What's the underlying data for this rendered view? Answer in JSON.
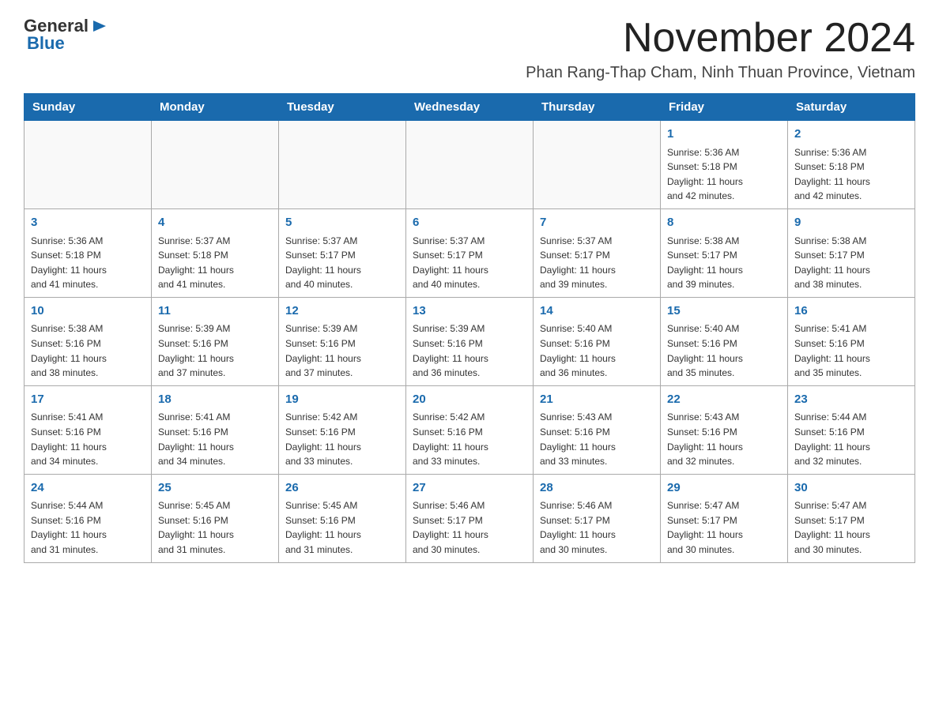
{
  "header": {
    "title": "November 2024",
    "location": "Phan Rang-Thap Cham, Ninh Thuan Province, Vietnam",
    "logo_general": "General",
    "logo_blue": "Blue"
  },
  "days_of_week": [
    "Sunday",
    "Monday",
    "Tuesday",
    "Wednesday",
    "Thursday",
    "Friday",
    "Saturday"
  ],
  "weeks": [
    [
      {
        "day": "",
        "info": ""
      },
      {
        "day": "",
        "info": ""
      },
      {
        "day": "",
        "info": ""
      },
      {
        "day": "",
        "info": ""
      },
      {
        "day": "",
        "info": ""
      },
      {
        "day": "1",
        "info": "Sunrise: 5:36 AM\nSunset: 5:18 PM\nDaylight: 11 hours\nand 42 minutes."
      },
      {
        "day": "2",
        "info": "Sunrise: 5:36 AM\nSunset: 5:18 PM\nDaylight: 11 hours\nand 42 minutes."
      }
    ],
    [
      {
        "day": "3",
        "info": "Sunrise: 5:36 AM\nSunset: 5:18 PM\nDaylight: 11 hours\nand 41 minutes."
      },
      {
        "day": "4",
        "info": "Sunrise: 5:37 AM\nSunset: 5:18 PM\nDaylight: 11 hours\nand 41 minutes."
      },
      {
        "day": "5",
        "info": "Sunrise: 5:37 AM\nSunset: 5:17 PM\nDaylight: 11 hours\nand 40 minutes."
      },
      {
        "day": "6",
        "info": "Sunrise: 5:37 AM\nSunset: 5:17 PM\nDaylight: 11 hours\nand 40 minutes."
      },
      {
        "day": "7",
        "info": "Sunrise: 5:37 AM\nSunset: 5:17 PM\nDaylight: 11 hours\nand 39 minutes."
      },
      {
        "day": "8",
        "info": "Sunrise: 5:38 AM\nSunset: 5:17 PM\nDaylight: 11 hours\nand 39 minutes."
      },
      {
        "day": "9",
        "info": "Sunrise: 5:38 AM\nSunset: 5:17 PM\nDaylight: 11 hours\nand 38 minutes."
      }
    ],
    [
      {
        "day": "10",
        "info": "Sunrise: 5:38 AM\nSunset: 5:16 PM\nDaylight: 11 hours\nand 38 minutes."
      },
      {
        "day": "11",
        "info": "Sunrise: 5:39 AM\nSunset: 5:16 PM\nDaylight: 11 hours\nand 37 minutes."
      },
      {
        "day": "12",
        "info": "Sunrise: 5:39 AM\nSunset: 5:16 PM\nDaylight: 11 hours\nand 37 minutes."
      },
      {
        "day": "13",
        "info": "Sunrise: 5:39 AM\nSunset: 5:16 PM\nDaylight: 11 hours\nand 36 minutes."
      },
      {
        "day": "14",
        "info": "Sunrise: 5:40 AM\nSunset: 5:16 PM\nDaylight: 11 hours\nand 36 minutes."
      },
      {
        "day": "15",
        "info": "Sunrise: 5:40 AM\nSunset: 5:16 PM\nDaylight: 11 hours\nand 35 minutes."
      },
      {
        "day": "16",
        "info": "Sunrise: 5:41 AM\nSunset: 5:16 PM\nDaylight: 11 hours\nand 35 minutes."
      }
    ],
    [
      {
        "day": "17",
        "info": "Sunrise: 5:41 AM\nSunset: 5:16 PM\nDaylight: 11 hours\nand 34 minutes."
      },
      {
        "day": "18",
        "info": "Sunrise: 5:41 AM\nSunset: 5:16 PM\nDaylight: 11 hours\nand 34 minutes."
      },
      {
        "day": "19",
        "info": "Sunrise: 5:42 AM\nSunset: 5:16 PM\nDaylight: 11 hours\nand 33 minutes."
      },
      {
        "day": "20",
        "info": "Sunrise: 5:42 AM\nSunset: 5:16 PM\nDaylight: 11 hours\nand 33 minutes."
      },
      {
        "day": "21",
        "info": "Sunrise: 5:43 AM\nSunset: 5:16 PM\nDaylight: 11 hours\nand 33 minutes."
      },
      {
        "day": "22",
        "info": "Sunrise: 5:43 AM\nSunset: 5:16 PM\nDaylight: 11 hours\nand 32 minutes."
      },
      {
        "day": "23",
        "info": "Sunrise: 5:44 AM\nSunset: 5:16 PM\nDaylight: 11 hours\nand 32 minutes."
      }
    ],
    [
      {
        "day": "24",
        "info": "Sunrise: 5:44 AM\nSunset: 5:16 PM\nDaylight: 11 hours\nand 31 minutes."
      },
      {
        "day": "25",
        "info": "Sunrise: 5:45 AM\nSunset: 5:16 PM\nDaylight: 11 hours\nand 31 minutes."
      },
      {
        "day": "26",
        "info": "Sunrise: 5:45 AM\nSunset: 5:16 PM\nDaylight: 11 hours\nand 31 minutes."
      },
      {
        "day": "27",
        "info": "Sunrise: 5:46 AM\nSunset: 5:17 PM\nDaylight: 11 hours\nand 30 minutes."
      },
      {
        "day": "28",
        "info": "Sunrise: 5:46 AM\nSunset: 5:17 PM\nDaylight: 11 hours\nand 30 minutes."
      },
      {
        "day": "29",
        "info": "Sunrise: 5:47 AM\nSunset: 5:17 PM\nDaylight: 11 hours\nand 30 minutes."
      },
      {
        "day": "30",
        "info": "Sunrise: 5:47 AM\nSunset: 5:17 PM\nDaylight: 11 hours\nand 30 minutes."
      }
    ]
  ]
}
